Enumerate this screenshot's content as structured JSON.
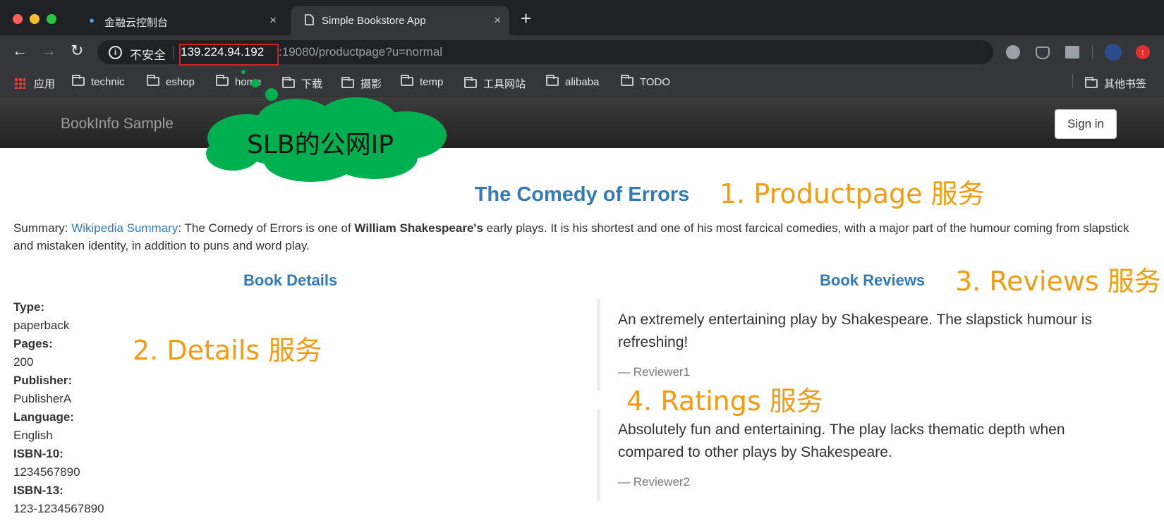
{
  "browser": {
    "tabs": [
      {
        "title": "金融云控制台",
        "icon": "pin-icon",
        "close": "×"
      },
      {
        "title": "Simple Bookstore App",
        "icon": "page-icon",
        "close": "×"
      }
    ],
    "new_tab": "+",
    "address": {
      "security_label": "不安全",
      "host": "139.224.94.192",
      "rest": ":19080/productpage?u=normal"
    },
    "bookmarks": [
      "应用",
      "technic",
      "eshop",
      "home",
      "下载",
      "摄影",
      "temp",
      "工具网站",
      "alibaba",
      "TODO"
    ],
    "other_bookmarks": "其他书签"
  },
  "app": {
    "brand": "BookInfo Sample",
    "signin": "Sign in"
  },
  "page": {
    "title": "The Comedy of Errors",
    "summary_prefix": "Summary: ",
    "summary_link": "Wikipedia Summary",
    "summary_mid": ": The Comedy of Errors is one of ",
    "summary_bold": "William Shakespeare's",
    "summary_end": " early plays. It is his shortest and one of his most farcical comedies, with a major part of the humour coming from slapstick and mistaken identity, in addition to puns and word play.",
    "details_title": "Book Details",
    "details": [
      {
        "label": "Type:",
        "value": "paperback"
      },
      {
        "label": "Pages:",
        "value": "200"
      },
      {
        "label": "Publisher:",
        "value": "PublisherA"
      },
      {
        "label": "Language:",
        "value": "English"
      },
      {
        "label": "ISBN-10:",
        "value": "1234567890"
      },
      {
        "label": "ISBN-13:",
        "value": "123-1234567890"
      }
    ],
    "reviews_title": "Book Reviews",
    "reviews": [
      {
        "text": "An extremely entertaining play by Shakespeare. The slapstick humour is refreshing!",
        "by": "— Reviewer1"
      },
      {
        "text": "Absolutely fun and entertaining. The play lacks thematic depth when compared to other plays by Shakespeare.",
        "by": "— Reviewer2"
      }
    ]
  },
  "annotations": {
    "cloud": "SLB的公网IP",
    "productpage": "1. Productpage 服务",
    "details": "2. Details 服务",
    "reviews": "3. Reviews 服务",
    "ratings": "4. Ratings 服务"
  },
  "colors": {
    "annotation": "#f39c12",
    "cloud": "#00b050",
    "highlight_box": "#d0232a",
    "link": "#337ab7"
  }
}
